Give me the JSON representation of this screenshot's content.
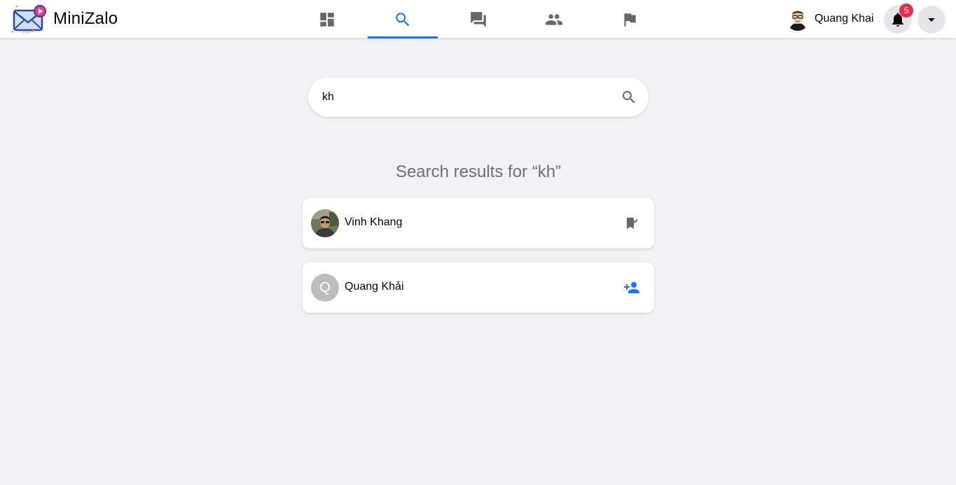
{
  "app": {
    "name": "MiniZalo"
  },
  "nav": {
    "tabs": [
      {
        "id": "dashboard",
        "icon": "dashboard-icon",
        "active": false
      },
      {
        "id": "search",
        "icon": "search-icon",
        "active": true
      },
      {
        "id": "messages",
        "icon": "chat-icon",
        "active": false
      },
      {
        "id": "friends",
        "icon": "people-icon",
        "active": false
      },
      {
        "id": "reports",
        "icon": "flag-icon",
        "active": false
      }
    ]
  },
  "user": {
    "name": "Quang Khai"
  },
  "notifications": {
    "count": "5"
  },
  "search": {
    "value": "kh",
    "placeholder": ""
  },
  "results": {
    "title": "Search results for “kh”",
    "items": [
      {
        "name": "Vinh Khang",
        "avatar": "photo",
        "action_icon": "bookmark-check-icon"
      },
      {
        "name": "Quang Khải",
        "avatar_letter": "Q",
        "action_icon": "person-add-icon"
      }
    ]
  },
  "colors": {
    "accent": "#1877f2",
    "background": "#f0f2f5",
    "badge": "#f02849",
    "icon_gray": "#65676b",
    "letter_avatar": "#bdbdbd"
  }
}
